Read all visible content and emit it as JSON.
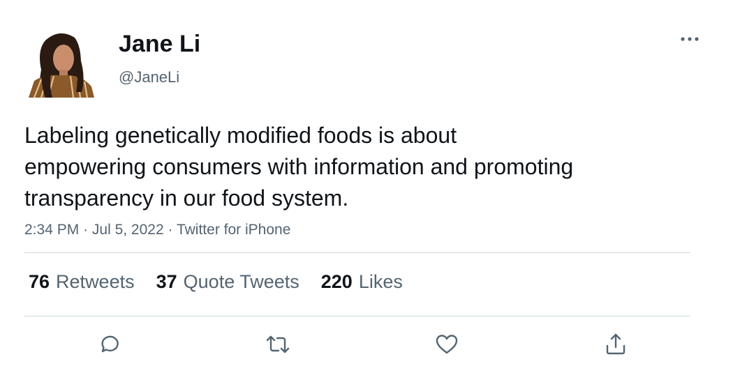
{
  "author": {
    "display_name": "Jane Li",
    "handle": "@JaneLi"
  },
  "tweet": {
    "text": "Labeling genetically modified foods is about\nempowering consumers with information and promoting\ntransparency in our food system.",
    "time": "2:34 PM",
    "separator": "·",
    "date": "Jul 5, 2022",
    "source": "Twitter for iPhone"
  },
  "stats": {
    "retweets_count": "76",
    "retweets_label": "Retweets",
    "quotes_count": "37",
    "quotes_label": "Quote Tweets",
    "likes_count": "220",
    "likes_label": "Likes"
  },
  "icons": {
    "more": "more-horizontal-icon",
    "reply": "reply-icon",
    "retweet": "retweet-icon",
    "like": "heart-icon",
    "share": "share-icon"
  },
  "colors": {
    "text_primary": "#0f1419",
    "text_secondary": "#536471",
    "divider": "#cfd9de"
  }
}
